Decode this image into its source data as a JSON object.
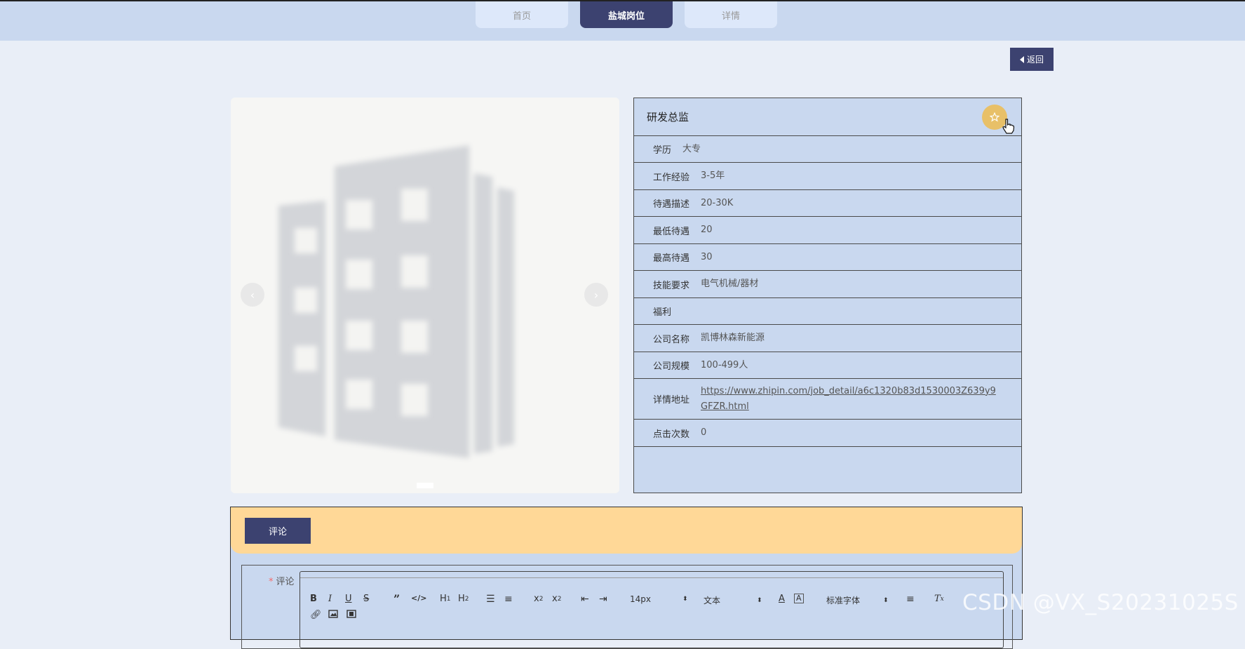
{
  "nav": {
    "tabs": [
      "首页",
      "盐城岗位",
      "详情"
    ],
    "active_index": 1
  },
  "back_label": "返回",
  "job": {
    "title": "研发总监",
    "fields": [
      {
        "label": "学历",
        "value": "大专"
      },
      {
        "label": "工作经验",
        "value": "3-5年"
      },
      {
        "label": "待遇描述",
        "value": "20-30K"
      },
      {
        "label": "最低待遇",
        "value": "20"
      },
      {
        "label": "最高待遇",
        "value": "30"
      },
      {
        "label": "技能要求",
        "value": "电气机械/器材"
      },
      {
        "label": "福利",
        "value": ""
      },
      {
        "label": "公司名称",
        "value": "凯博林森新能源"
      },
      {
        "label": "公司规模",
        "value": "100-499人"
      },
      {
        "label": "详情地址",
        "value": "https://www.zhipin.com/job_detail/a6c1320b83d1530003Z639y9GFZR.html"
      },
      {
        "label": "点击次数",
        "value": "0"
      }
    ]
  },
  "comment": {
    "tab_label": "评论",
    "field_label": "评论",
    "toolbar": {
      "font_size": "14px",
      "header": "文本",
      "font_family": "标准字体"
    }
  },
  "watermark": "CSDN @VX_S20231025S",
  "colors": {
    "primary": "#3c4270",
    "header_bg": "#c9d8ef",
    "accent": "#ffd897",
    "favorite": "#e8c068"
  }
}
